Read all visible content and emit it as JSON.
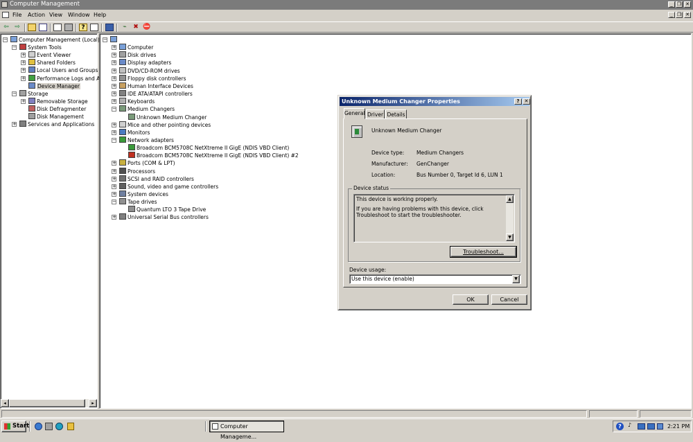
{
  "window": {
    "title": "Computer Management",
    "buttons": [
      "_",
      "❐",
      "✕"
    ]
  },
  "menu": [
    "File",
    "Action",
    "View",
    "Window",
    "Help"
  ],
  "left_tree": [
    {
      "label": "Computer Management (Local)",
      "icon": "computer-management-icon",
      "level": 0,
      "expander": "−"
    },
    {
      "label": "System Tools",
      "icon": "toolbox-icon",
      "level": 1,
      "expander": "−"
    },
    {
      "label": "Event Viewer",
      "icon": "event-viewer-icon",
      "level": 2,
      "expander": "+"
    },
    {
      "label": "Shared Folders",
      "icon": "shared-folder-icon",
      "level": 2,
      "expander": "+"
    },
    {
      "label": "Local Users and Groups",
      "icon": "users-icon",
      "level": 2,
      "expander": "+"
    },
    {
      "label": "Performance Logs and Alerts",
      "icon": "performance-icon",
      "level": 2,
      "expander": "+"
    },
    {
      "label": "Device Manager",
      "icon": "device-manager-icon",
      "level": 2,
      "expander": "",
      "selected": true
    },
    {
      "label": "Storage",
      "icon": "storage-icon",
      "level": 1,
      "expander": "−"
    },
    {
      "label": "Removable Storage",
      "icon": "removable-storage-icon",
      "level": 2,
      "expander": "+"
    },
    {
      "label": "Disk Defragmenter",
      "icon": "defragmenter-icon",
      "level": 2,
      "expander": ""
    },
    {
      "label": "Disk Management",
      "icon": "disk-management-icon",
      "level": 2,
      "expander": ""
    },
    {
      "label": "Services and Applications",
      "icon": "services-icon",
      "level": 1,
      "expander": "+"
    }
  ],
  "device_tree": [
    {
      "label": "",
      "icon": "computer-root-icon",
      "level": 0,
      "expander": "−"
    },
    {
      "label": "Computer",
      "icon": "computer-icon",
      "level": 1,
      "expander": "+"
    },
    {
      "label": "Disk drives",
      "icon": "disk-drive-icon",
      "level": 1,
      "expander": "+"
    },
    {
      "label": "Display adapters",
      "icon": "display-adapter-icon",
      "level": 1,
      "expander": "+"
    },
    {
      "label": "DVD/CD-ROM drives",
      "icon": "cdrom-icon",
      "level": 1,
      "expander": "+"
    },
    {
      "label": "Floppy disk controllers",
      "icon": "floppy-controller-icon",
      "level": 1,
      "expander": "+"
    },
    {
      "label": "Human Interface Devices",
      "icon": "hid-icon",
      "level": 1,
      "expander": "+"
    },
    {
      "label": "IDE ATA/ATAPI controllers",
      "icon": "ide-controller-icon",
      "level": 1,
      "expander": "+"
    },
    {
      "label": "Keyboards",
      "icon": "keyboard-icon",
      "level": 1,
      "expander": "+"
    },
    {
      "label": "Medium Changers",
      "icon": "medium-changer-icon",
      "level": 1,
      "expander": "−"
    },
    {
      "label": "Unknown Medium Changer",
      "icon": "medium-changer-device-icon",
      "level": 2,
      "expander": ""
    },
    {
      "label": "Mice and other pointing devices",
      "icon": "mouse-icon",
      "level": 1,
      "expander": "+"
    },
    {
      "label": "Monitors",
      "icon": "monitor-icon",
      "level": 1,
      "expander": "+"
    },
    {
      "label": "Network adapters",
      "icon": "network-adapter-icon",
      "level": 1,
      "expander": "−"
    },
    {
      "label": "Broadcom BCM5708C NetXtreme II GigE (NDIS VBD Client)",
      "icon": "network-card-icon",
      "level": 2,
      "expander": ""
    },
    {
      "label": "Broadcom BCM5708C NetXtreme II GigE (NDIS VBD Client) #2",
      "icon": "network-card-disabled-icon",
      "level": 2,
      "expander": ""
    },
    {
      "label": "Ports (COM & LPT)",
      "icon": "port-icon",
      "level": 1,
      "expander": "+"
    },
    {
      "label": "Processors",
      "icon": "processor-icon",
      "level": 1,
      "expander": "+"
    },
    {
      "label": "SCSI and RAID controllers",
      "icon": "scsi-icon",
      "level": 1,
      "expander": "+"
    },
    {
      "label": "Sound, video and game controllers",
      "icon": "sound-icon",
      "level": 1,
      "expander": "+"
    },
    {
      "label": "System devices",
      "icon": "system-device-icon",
      "level": 1,
      "expander": "+"
    },
    {
      "label": "Tape drives",
      "icon": "tape-drive-icon",
      "level": 1,
      "expander": "−"
    },
    {
      "label": "Quantum LTO 3 Tape Drive",
      "icon": "tape-device-icon",
      "level": 2,
      "expander": ""
    },
    {
      "label": "Universal Serial Bus controllers",
      "icon": "usb-icon",
      "level": 1,
      "expander": "+"
    }
  ],
  "dialog": {
    "title": "Unknown Medium Changer Properties",
    "help_button": "?",
    "close_button": "✕",
    "tabs": [
      "General",
      "Driver",
      "Details"
    ],
    "device_name": "Unknown Medium Changer",
    "device_type_label": "Device type:",
    "device_type": "Medium Changers",
    "manufacturer_label": "Manufacturer:",
    "manufacturer": "GenChanger",
    "location_label": "Location:",
    "location": "Bus Number 0, Target Id 6, LUN 1",
    "status_group_label": "Device status",
    "status_line1": "This device is working properly.",
    "status_line2": "If you are having problems with this device, click Troubleshoot to start the troubleshooter.",
    "troubleshoot_button": "Troubleshoot...",
    "usage_label": "Device usage:",
    "usage_value": "Use this device (enable)",
    "ok_button": "OK",
    "cancel_button": "Cancel"
  },
  "taskbar": {
    "start_label": "Start",
    "task_label": "Computer Manageme...",
    "clock": "2:21 PM"
  },
  "colors": {
    "face": "#d4d0c8",
    "titlebar_active_start": "#0a246a",
    "titlebar_active_end": "#a6caf0",
    "titlebar_inactive": "#7b7b7b"
  }
}
